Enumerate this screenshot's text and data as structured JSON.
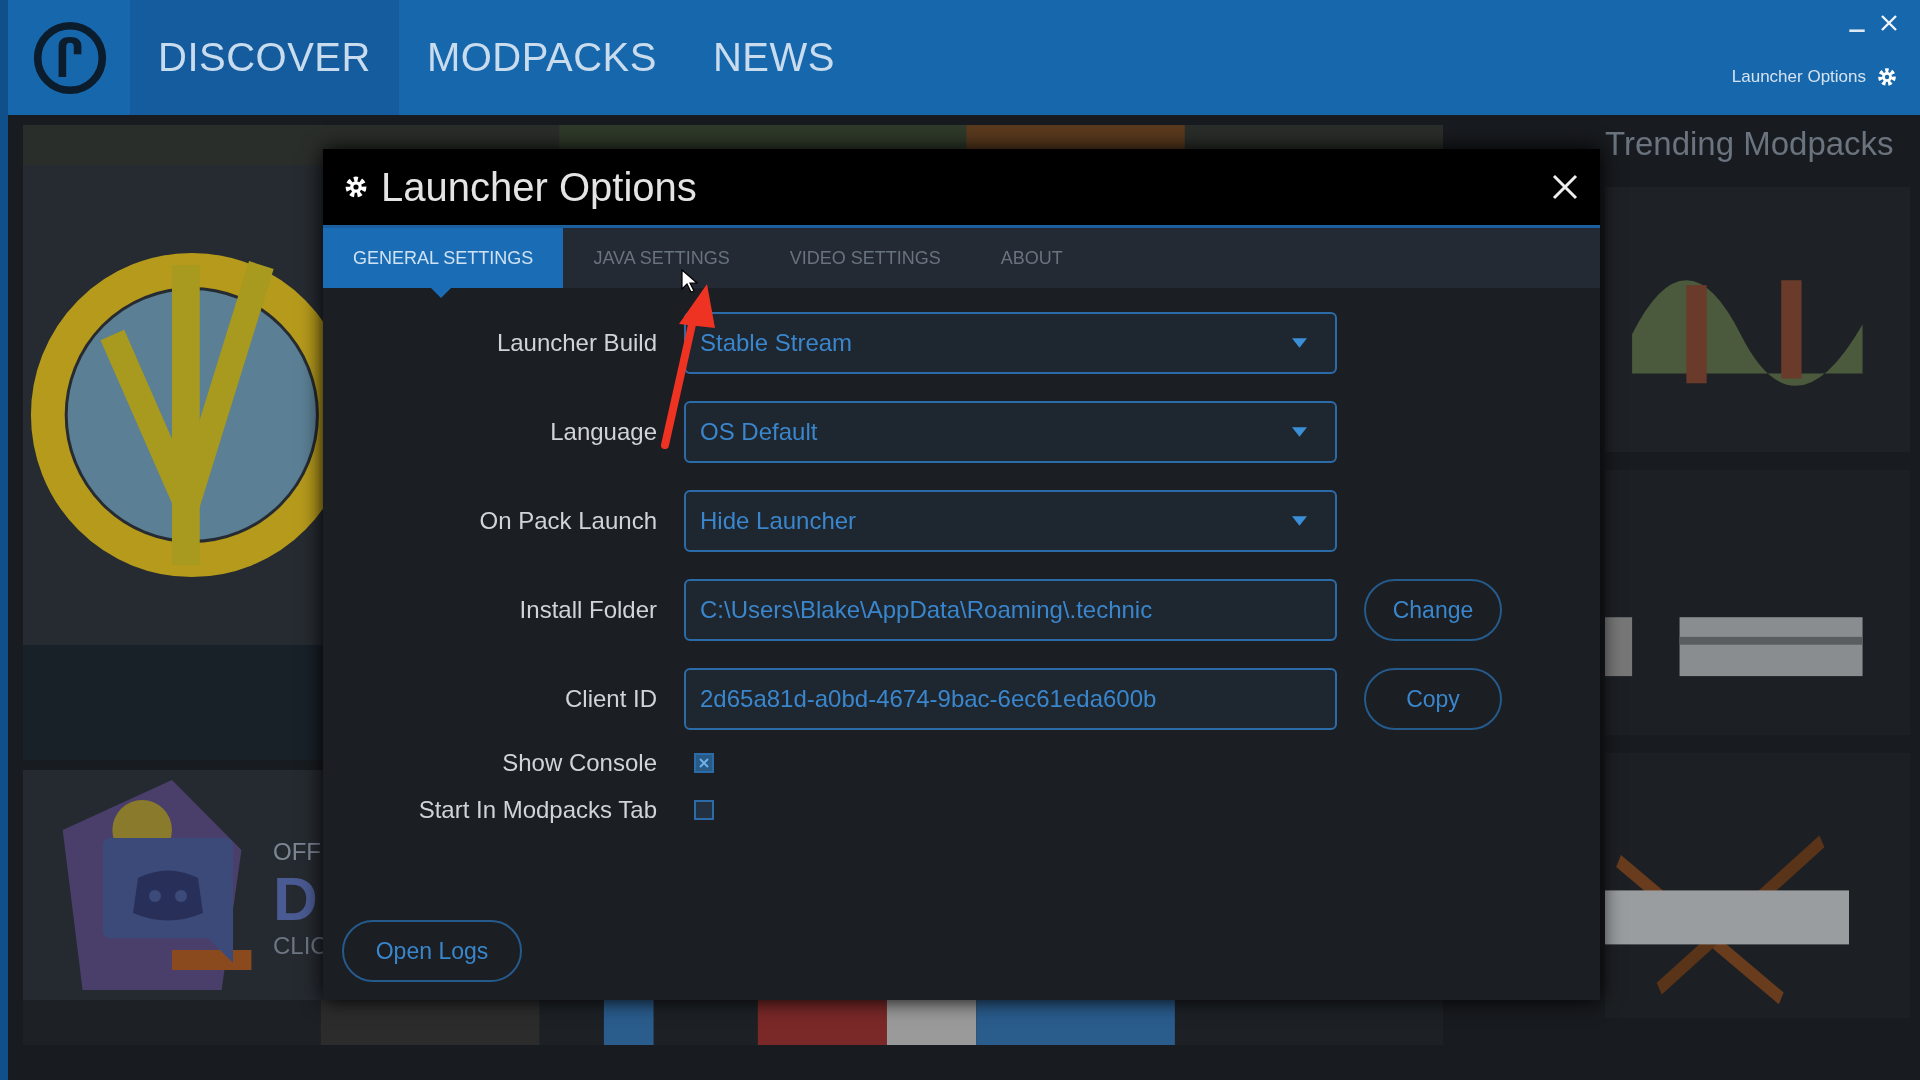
{
  "topbar": {
    "nav": [
      {
        "label": "DISCOVER",
        "selected": true
      },
      {
        "label": "MODPACKS",
        "selected": false
      },
      {
        "label": "NEWS",
        "selected": false
      }
    ],
    "options_link": "Launcher Options"
  },
  "background": {
    "discord_card": {
      "kicker": "OFF",
      "big": "D",
      "hint": "CLIC"
    },
    "trending": {
      "title": "Trending Modpacks"
    }
  },
  "dialog": {
    "title": "Launcher Options",
    "tabs": [
      {
        "label": "GENERAL SETTINGS",
        "selected": true
      },
      {
        "label": "JAVA SETTINGS",
        "selected": false
      },
      {
        "label": "VIDEO SETTINGS",
        "selected": false
      },
      {
        "label": "ABOUT",
        "selected": false
      }
    ],
    "fields": [
      {
        "kind": "dropdown",
        "label": "Launcher Build",
        "value": "Stable Stream"
      },
      {
        "kind": "dropdown",
        "label": "Language",
        "value": "OS Default"
      },
      {
        "kind": "dropdown",
        "label": "On Pack Launch",
        "value": "Hide Launcher"
      },
      {
        "kind": "text",
        "label": "Install Folder",
        "value": "C:\\Users\\Blake\\AppData\\Roaming\\.technic",
        "button": "Change"
      },
      {
        "kind": "text",
        "label": "Client ID",
        "value": "2d65a81d-a0bd-4674-9bac-6ec61eda600b",
        "button": "Copy"
      }
    ],
    "checkboxes": [
      {
        "label": "Show Console",
        "checked": true
      },
      {
        "label": "Start In Modpacks Tab",
        "checked": false
      }
    ],
    "footer_button": "Open Logs"
  }
}
